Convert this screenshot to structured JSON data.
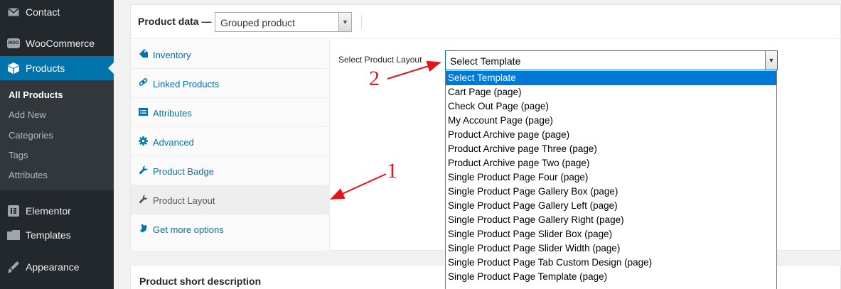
{
  "sidebar": {
    "menu": [
      {
        "label": "Contact",
        "icon": "mail-icon"
      },
      {
        "label": "WooCommerce",
        "icon": "woocommerce-icon",
        "badge": "WOO"
      },
      {
        "label": "Products",
        "icon": "box-icon",
        "active": true
      },
      {
        "label": "Elementor",
        "icon": "elementor-icon"
      },
      {
        "label": "Templates",
        "icon": "folder-icon"
      },
      {
        "label": "Appearance",
        "icon": "brush-icon"
      }
    ],
    "submenu": [
      {
        "label": "All Products",
        "current": true
      },
      {
        "label": "Add New"
      },
      {
        "label": "Categories"
      },
      {
        "label": "Tags"
      },
      {
        "label": "Attributes"
      }
    ]
  },
  "product_data": {
    "label": "Product data —",
    "type_select_value": "Grouped product",
    "tabs": [
      {
        "label": "Inventory",
        "icon": "tag-icon"
      },
      {
        "label": "Linked Products",
        "icon": "link-icon"
      },
      {
        "label": "Attributes",
        "icon": "list-icon"
      },
      {
        "label": "Advanced",
        "icon": "gear-icon"
      },
      {
        "label": "Product Badge",
        "icon": "wrench-icon"
      },
      {
        "label": "Product Layout",
        "icon": "wrench-icon",
        "active": true
      },
      {
        "label": "Get more options",
        "icon": "plugin-icon"
      }
    ],
    "layout_field_label": "Select Product Layout",
    "layout_select_value": "Select Template",
    "layout_options": [
      "Select Template",
      "Cart Page (page)",
      "Check Out Page (page)",
      "My Account Page (page)",
      "Product Archive page (page)",
      "Product Archive page Three (page)",
      "Product Archive page Two (page)",
      "Single Product Page Four (page)",
      "Single Product Page Gallery Box (page)",
      "Single Product Page Gallery Left (page)",
      "Single Product Page Gallery Right (page)",
      "Single Product Page Slider Box (page)",
      "Single Product Page Slider Width (page)",
      "Single Product Page Tab Custom Design (page)",
      "Single Product Page Template (page)"
    ]
  },
  "short_description": {
    "title": "Product short description"
  },
  "annotations": {
    "marker_1": "1",
    "marker_2": "2",
    "color": "#e8121a"
  },
  "colors": {
    "sidebar_bg": "#23282d",
    "active_menu": "#0073aa",
    "link": "#0073aa",
    "selected_option": "#0078d7"
  }
}
